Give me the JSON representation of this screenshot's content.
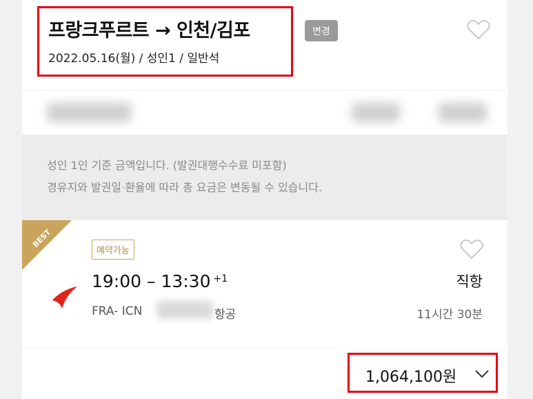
{
  "header": {
    "title": "프랑크푸르트 → 인천/김포",
    "subtitle": "2022.05.16(월) / 성인1 / 일반석",
    "change_label": "변경"
  },
  "notice": {
    "line1": "성인 1인 기준 금액입니다. (발권대행수수료 미포함)",
    "line2": "경유지와 발권일·환율에 따라 총 요금은 변동될 수 있습니다."
  },
  "flight": {
    "badge": "BEST",
    "tag": "예약가능",
    "time": "19:00 – 13:30",
    "day_offset": "+1",
    "stops": "직항",
    "route": "FRA- ICN",
    "airline_suffix": "항공",
    "duration": "11시간 30분",
    "price": "1,064,100원"
  },
  "icons": {
    "favorite": "heart-icon",
    "expand": "chevron-down-icon",
    "airline_logo": "airline-logo-icon"
  },
  "colors": {
    "highlight_border": "#e60012",
    "best_ribbon": "#c9a45a",
    "tag_border": "#c9a45a",
    "airline_logo": "#e2231a"
  }
}
